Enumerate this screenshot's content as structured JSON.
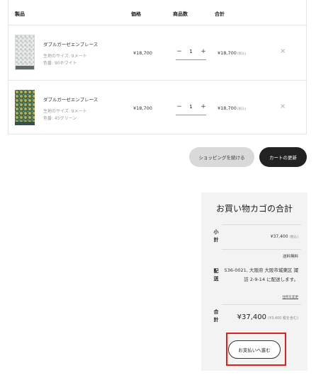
{
  "table": {
    "headers": {
      "product": "製品",
      "price": "価格",
      "quantity": "商品数",
      "total": "合計"
    },
    "items": [
      {
        "name": "ダブルガーゼエンブレース",
        "size": "生地のサイズ: 9メート",
        "color": "色番: 90ホワイト",
        "price": "¥18,700",
        "quantity": "1",
        "subtotal": "¥18,700",
        "tax_note": "(税込)",
        "remove": "×",
        "minus": "−",
        "plus": "+"
      },
      {
        "name": "ダブルガーゼエンブレース",
        "size": "生地のサイズ: 9メート",
        "color": "色番: 45グリーン",
        "price": "¥18,700",
        "quantity": "1",
        "subtotal": "¥18,700",
        "tax_note": "(税込)",
        "remove": "×",
        "minus": "−",
        "plus": "+"
      }
    ]
  },
  "actions": {
    "continue_label": "ショッピングを続ける",
    "update_label": "カートの更新"
  },
  "summary": {
    "title": "お買い物カゴの合計",
    "subtotal_label": "小計",
    "subtotal_value": "¥37,400",
    "subtotal_tax": "(税込)",
    "shipping_label": "配送",
    "shipping_free": "送料無料",
    "shipping_address": "536-0021, 大阪府 大阪市城東区 諏訪 2-9-14 に配送します。",
    "shipping_change": "住所を変更",
    "total_label": "合計",
    "total_value": "¥37,400",
    "total_tax": "(¥3,400 税を含む)",
    "checkout_label": "お支払いへ進む"
  },
  "colors": {
    "accent_dark": "#222222",
    "highlight": "#e0201b",
    "summary_bg": "#f3f3f3"
  }
}
